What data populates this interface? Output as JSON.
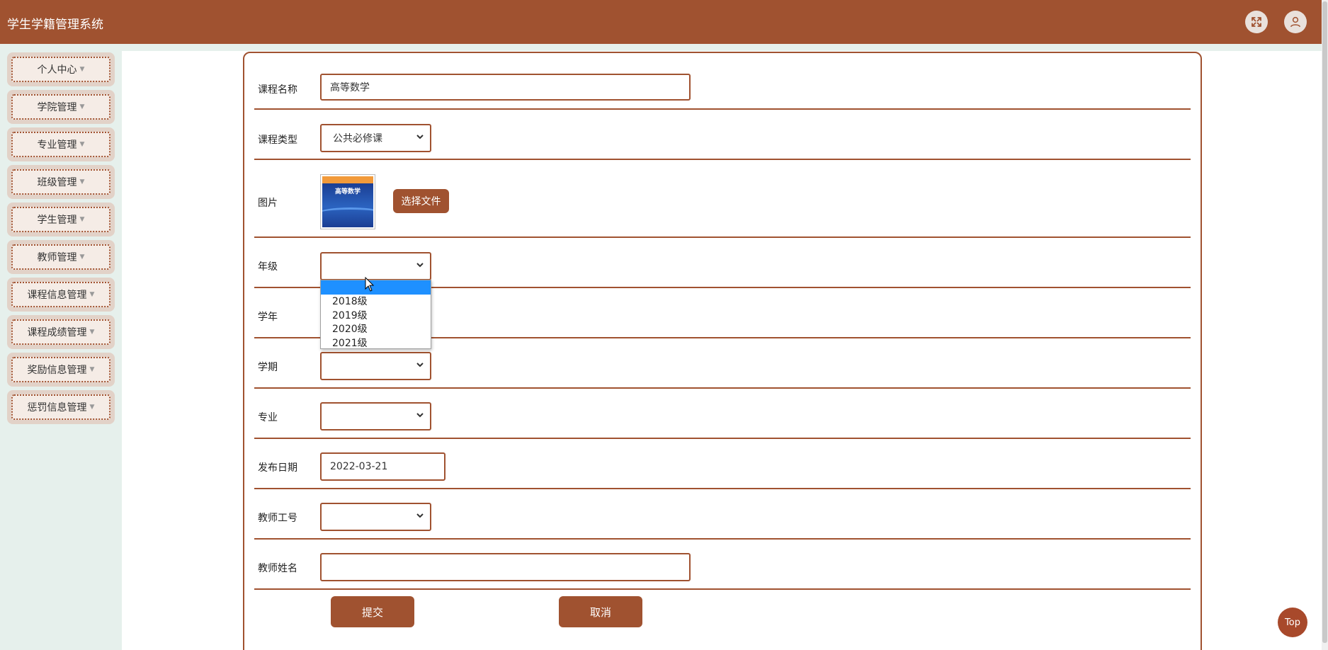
{
  "app": {
    "title": "学生学籍管理系统"
  },
  "header": {
    "fullscreen_icon": "fullscreen-icon",
    "user_icon": "user-icon"
  },
  "sidebar": {
    "items": [
      {
        "label": "个人中心"
      },
      {
        "label": "学院管理"
      },
      {
        "label": "专业管理"
      },
      {
        "label": "班级管理"
      },
      {
        "label": "学生管理"
      },
      {
        "label": "教师管理"
      },
      {
        "label": "课程信息管理"
      },
      {
        "label": "课程成绩管理"
      },
      {
        "label": "奖励信息管理"
      },
      {
        "label": "惩罚信息管理"
      }
    ]
  },
  "form": {
    "course_name": {
      "label": "课程名称",
      "value": "高等数学"
    },
    "course_type": {
      "label": "课程类型",
      "value": "公共必修课"
    },
    "image": {
      "label": "图片",
      "book_title": "高等数学",
      "button": "选择文件"
    },
    "grade": {
      "label": "年级",
      "value": "",
      "options": [
        "",
        "2018级",
        "2019级",
        "2020级",
        "2021级"
      ]
    },
    "school_year": {
      "label": "学年"
    },
    "term": {
      "label": "学期",
      "value": ""
    },
    "major": {
      "label": "专业",
      "value": ""
    },
    "publish_date": {
      "label": "发布日期",
      "value": "2022-03-21"
    },
    "teacher_id": {
      "label": "教师工号",
      "value": ""
    },
    "teacher_name": {
      "label": "教师姓名",
      "value": ""
    },
    "submit": "提交",
    "cancel": "取消"
  },
  "back_to_top": "Top",
  "colors": {
    "primary": "#a05230",
    "sidebar_bg": "#e6f0ec",
    "highlight": "#1e90ff"
  }
}
